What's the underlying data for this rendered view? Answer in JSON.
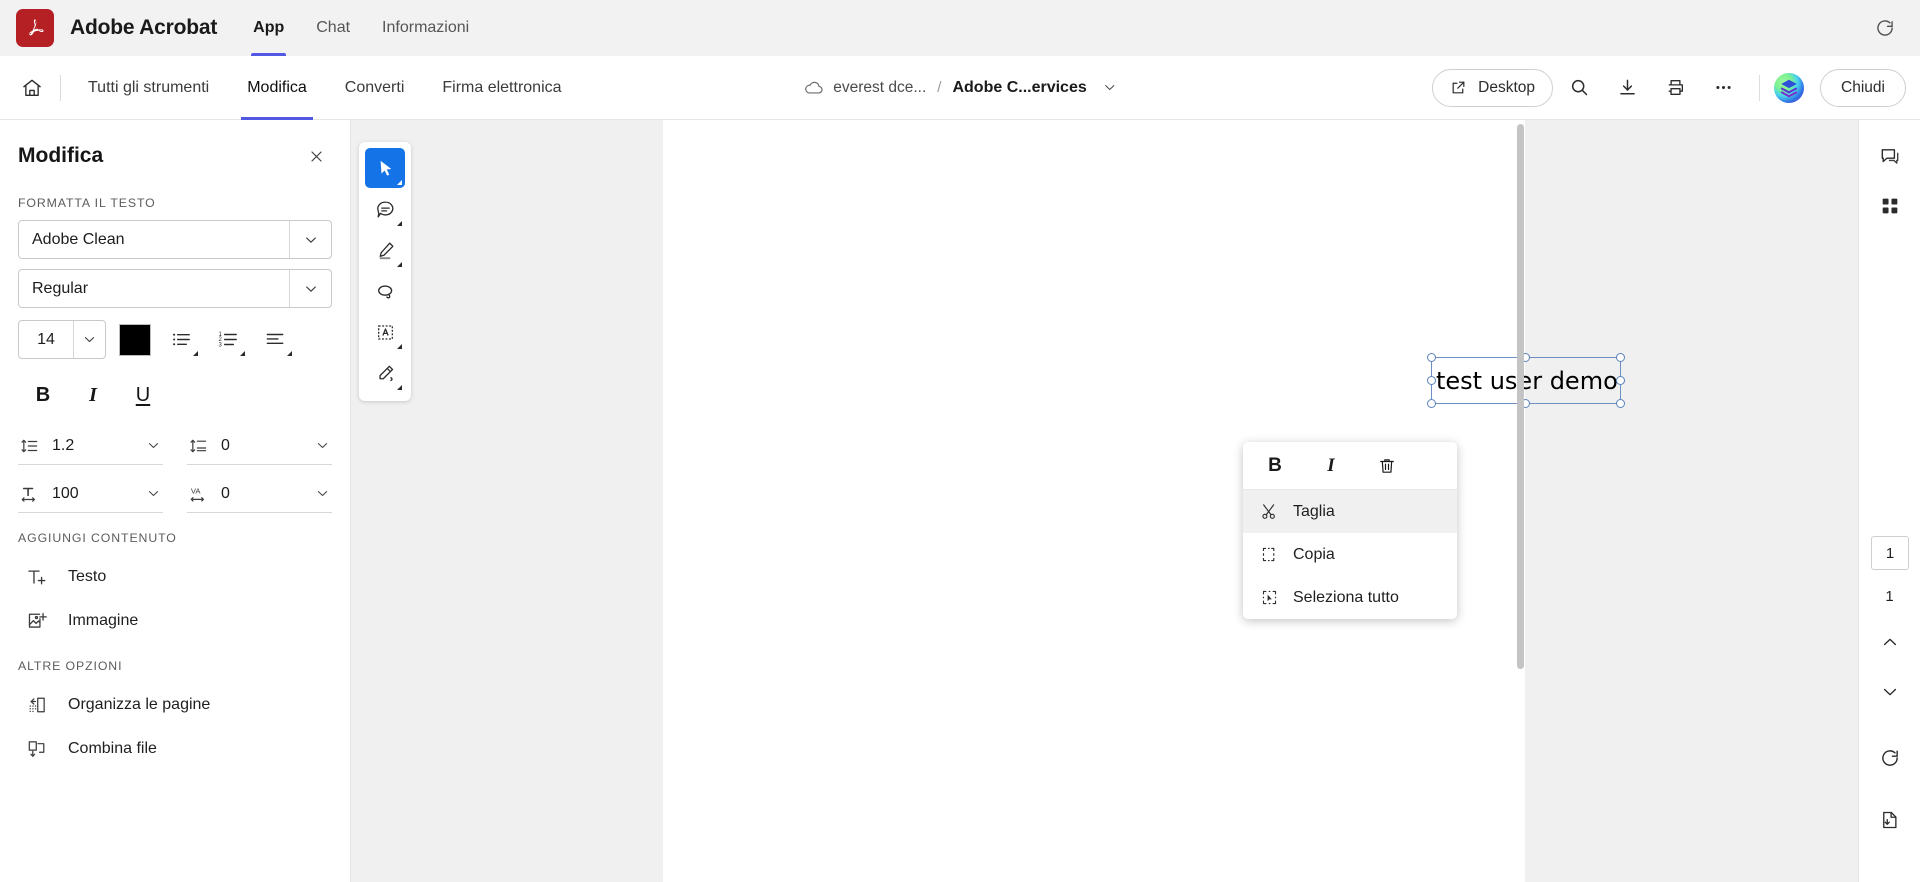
{
  "titlebar": {
    "app_name": "Adobe Acrobat",
    "logo_icon": "acrobat-logo-icon",
    "tabs": [
      {
        "label": "App",
        "active": true
      },
      {
        "label": "Chat",
        "active": false
      },
      {
        "label": "Informazioni",
        "active": false
      }
    ],
    "refresh_icon": "refresh-icon",
    "accent_color": "#5258e4",
    "brand_color": "#b52025",
    "background": "#f2f2f2"
  },
  "toolbar": {
    "home_icon": "home-icon",
    "tabs": [
      {
        "label": "Tutti gli strumenti",
        "active": false
      },
      {
        "label": "Modifica",
        "active": true
      },
      {
        "label": "Converti",
        "active": false
      },
      {
        "label": "Firma elettronica",
        "active": false
      }
    ],
    "breadcrumb": {
      "cloud_icon": "cloud-icon",
      "folder": "everest dce...",
      "separator": "/",
      "file": "Adobe C...ervices",
      "chevron_icon": "chevron-down-icon"
    },
    "desktop_button": {
      "label": "Desktop",
      "icon": "external-link-icon"
    },
    "icons": [
      {
        "name": "search-icon"
      },
      {
        "name": "download-icon"
      },
      {
        "name": "print-icon"
      },
      {
        "name": "more-options-icon"
      }
    ],
    "avatar_icon": "avatar-layers-icon",
    "close_button": "Chiudi"
  },
  "left_panel": {
    "title": "Modifica",
    "close_icon": "close-icon",
    "format_section": {
      "label": "FORMATTA IL TESTO",
      "font_family": {
        "value": "Adobe Clean",
        "chevron": "chevron-down-icon"
      },
      "font_style": {
        "value": "Regular",
        "chevron": "chevron-down-icon"
      },
      "font_size": {
        "value": "14",
        "chevron": "chevron-down-icon"
      },
      "color_swatch": "#000000",
      "list_buttons": [
        {
          "name": "bulleted-list-icon"
        },
        {
          "name": "numbered-list-icon"
        },
        {
          "name": "text-align-icon"
        }
      ],
      "style_buttons": [
        {
          "name": "bold-button",
          "label": "B"
        },
        {
          "name": "italic-button",
          "label": "I"
        },
        {
          "name": "underline-button",
          "label": "U"
        }
      ],
      "spacing": [
        {
          "icon": "line-spacing-icon",
          "value": "1.2"
        },
        {
          "icon": "paragraph-spacing-icon",
          "value": "0"
        },
        {
          "icon": "horizontal-scale-icon",
          "value": "100"
        },
        {
          "icon": "letter-spacing-icon",
          "value": "0",
          "glyph": "VA"
        }
      ]
    },
    "add_content_section": {
      "label": "AGGIUNGI CONTENUTO",
      "items": [
        {
          "icon": "add-text-icon",
          "label": "Testo"
        },
        {
          "icon": "add-image-icon",
          "label": "Immagine"
        }
      ]
    },
    "other_options_section": {
      "label": "ALTRE OPZIONI",
      "items": [
        {
          "icon": "organize-pages-icon",
          "label": "Organizza le pagine"
        },
        {
          "icon": "combine-files-icon",
          "label": "Combina file"
        }
      ]
    }
  },
  "tool_rail": {
    "tools": [
      {
        "name": "select-tool",
        "icon": "cursor-icon",
        "active": true
      },
      {
        "name": "comment-tool",
        "icon": "comment-icon",
        "active": false
      },
      {
        "name": "highlight-tool",
        "icon": "highlighter-icon",
        "active": false
      },
      {
        "name": "lasso-tool",
        "icon": "lasso-icon",
        "active": false
      },
      {
        "name": "text-select-tool",
        "icon": "text-box-icon",
        "active": false
      },
      {
        "name": "draw-tool",
        "icon": "pen-icon",
        "active": false
      }
    ],
    "active_color": "#1473e6"
  },
  "document": {
    "selected_textbox": {
      "text": "test user demo",
      "selection_color": "#6d8fc4"
    }
  },
  "context_menu": {
    "format_buttons": [
      {
        "name": "bold-button",
        "label": "B"
      },
      {
        "name": "italic-button",
        "label": "I"
      },
      {
        "name": "delete-button",
        "icon": "trash-icon"
      }
    ],
    "items": [
      {
        "icon": "cut-icon",
        "label": "Taglia",
        "hover": true
      },
      {
        "icon": "copy-icon",
        "label": "Copia",
        "hover": false
      },
      {
        "icon": "select-all-icon",
        "label": "Seleziona tutto",
        "hover": false
      }
    ]
  },
  "right_rail": {
    "top_icons": [
      {
        "name": "comments-panel-icon"
      },
      {
        "name": "thumbnails-panel-icon"
      }
    ],
    "page_current": "1",
    "page_total": "1",
    "nav_icons": [
      {
        "name": "page-up-icon"
      },
      {
        "name": "page-down-icon"
      }
    ],
    "bottom_icons": [
      {
        "name": "rotate-icon"
      },
      {
        "name": "export-icon"
      }
    ]
  }
}
